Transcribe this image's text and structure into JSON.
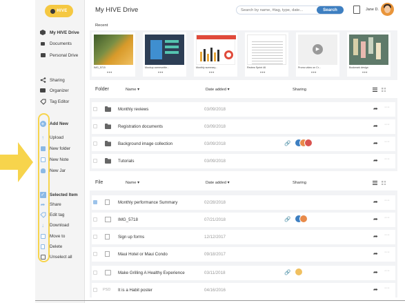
{
  "header": {
    "logo_text": "HIVE",
    "title": "My HIVE Drive",
    "search_placeholder": "Search by name, #tag, type, date...",
    "search_button": "Search",
    "user_name": "Jane D."
  },
  "sidebar": {
    "nav": [
      {
        "label": "My HIVE Drive",
        "icon": "hexagon-icon"
      },
      {
        "label": "Documents",
        "icon": "documents-icon"
      },
      {
        "label": "Personal Drive",
        "icon": "personal-drive-icon"
      },
      {
        "label": "Sharing",
        "icon": "sharing-icon"
      },
      {
        "label": "Organizer",
        "icon": "organizer-icon"
      },
      {
        "label": "Tag Editor",
        "icon": "tag-icon"
      }
    ],
    "add_new": {
      "title": "Add New",
      "items": [
        {
          "label": "Upload",
          "icon": "upload-icon"
        },
        {
          "label": "New folder",
          "icon": "folder-icon"
        },
        {
          "label": "New Note",
          "icon": "note-icon"
        },
        {
          "label": "New Jar",
          "icon": "jar-icon"
        }
      ]
    },
    "selected": {
      "title": "Selected Item",
      "items": [
        {
          "label": "Share",
          "icon": "share-icon"
        },
        {
          "label": "Edit tag",
          "icon": "tag-icon"
        },
        {
          "label": "Download",
          "icon": "download-icon"
        },
        {
          "label": "Move to",
          "icon": "move-icon"
        },
        {
          "label": "Delete",
          "icon": "trash-icon"
        },
        {
          "label": "Unselect all",
          "icon": "checkbox-icon"
        }
      ]
    }
  },
  "recent": {
    "label": "Recent",
    "items": [
      {
        "name": "IMG_5715"
      },
      {
        "name": "Mockup communitie..."
      },
      {
        "name": "Monthly summary..."
      },
      {
        "name": "Review Sprint 46"
      },
      {
        "name": "Promo video on Cr..."
      },
      {
        "name": "Bookmark design"
      }
    ]
  },
  "folders": {
    "title": "Folder",
    "col_name": "Name ▾",
    "col_date": "Date added",
    "col_sharing": "Sharing",
    "rows": [
      {
        "name": "Monthly reviews",
        "date": "03/09/2018",
        "shared": false
      },
      {
        "name": "Registration documents",
        "date": "03/09/2018",
        "shared": false
      },
      {
        "name": "Background image collection",
        "date": "03/09/2018",
        "shared": true
      },
      {
        "name": "Tutorials",
        "date": "03/09/2018",
        "shared": false
      }
    ]
  },
  "files": {
    "title": "File",
    "col_name": "Name ▾",
    "col_date": "Date added",
    "col_sharing": "Sharing",
    "rows": [
      {
        "name": "Monthly performance Summary",
        "date": "02/28/2018",
        "type": "doc",
        "selected": true
      },
      {
        "name": "IMG_5718",
        "date": "07/21/2018",
        "type": "image"
      },
      {
        "name": "Sign up forms",
        "date": "12/12/2017",
        "type": "doc"
      },
      {
        "name": "Maui Hotel or Maui Condo",
        "date": "09/18/2017",
        "type": "doc"
      },
      {
        "name": "Make Grilling A Healthy Experience",
        "date": "03/11/2018",
        "type": "note"
      },
      {
        "name": "It is a Habit poster",
        "date": "04/16/2016",
        "type": "psd",
        "type_label": "PSD"
      }
    ]
  },
  "colors": {
    "accent": "#3e7fc1",
    "logo": "#f5c842",
    "highlight": "#f7d44c",
    "arrow": "#f7d44c"
  }
}
